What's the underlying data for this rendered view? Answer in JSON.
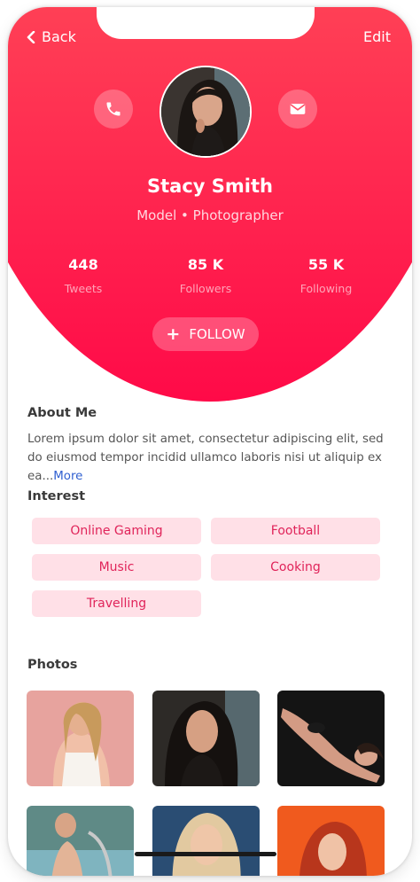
{
  "nav": {
    "back_label": "Back",
    "edit_label": "Edit"
  },
  "profile": {
    "name": "Stacy Smith",
    "role": "Model • Photographer"
  },
  "stats": [
    {
      "value": "448",
      "label": "Tweets"
    },
    {
      "value": "85 K",
      "label": "Followers"
    },
    {
      "value": "55 K",
      "label": "Following"
    }
  ],
  "follow": {
    "icon": "plus-icon",
    "label": "FOLLOW"
  },
  "about": {
    "title": "About Me",
    "text": "Lorem ipsum dolor sit amet, consectetur adipiscing elit, sed do eiusmod tempor incidid ullamco laboris nisi ut aliquip ex ea...",
    "more": "More"
  },
  "interest": {
    "title": "Interest",
    "items": [
      "Online Gaming",
      "Football",
      "Music",
      "Cooking",
      "Travelling"
    ]
  },
  "photos": {
    "title": "Photos"
  },
  "colors": {
    "header_top": "#ff6b55",
    "header_bottom": "#ff0a48",
    "chip_bg": "#ffe0e7",
    "chip_text": "#e0245a",
    "link": "#2f5fd0"
  },
  "icons": {
    "call": "phone-icon",
    "mail": "mail-icon",
    "back": "chevron-left-icon"
  }
}
